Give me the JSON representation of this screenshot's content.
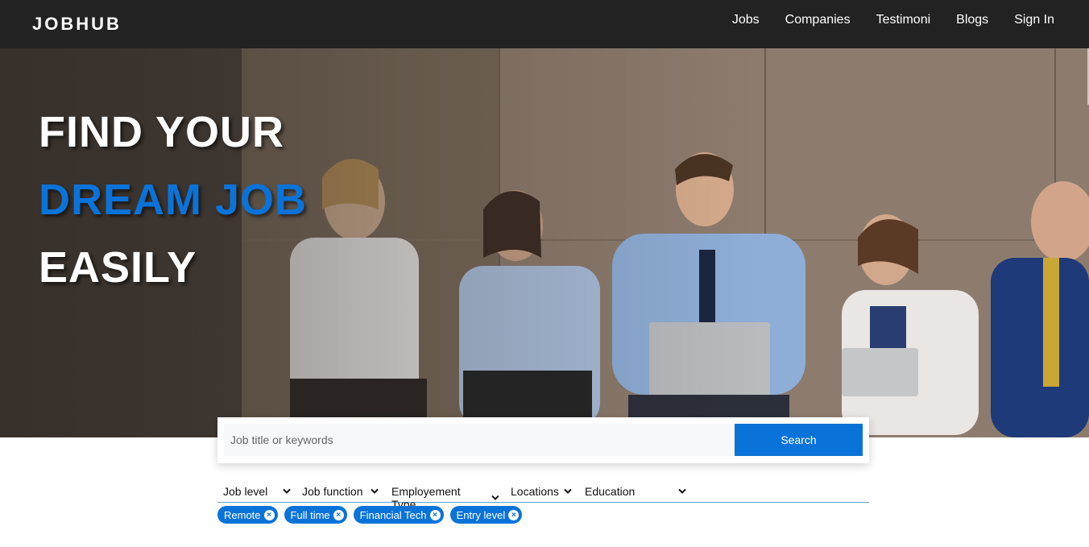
{
  "navbar": {
    "logo": "JOBHUB",
    "links": [
      "Jobs",
      "Companies",
      "Testimoni",
      "Blogs",
      "Sign In"
    ]
  },
  "hero": {
    "line1": "FIND YOUR",
    "line2": "DREAM JOB",
    "line3": "EASILY"
  },
  "search": {
    "placeholder": "Job title or keywords",
    "value": "",
    "button": "Search"
  },
  "filters": [
    "Job level",
    "Job function",
    "Employement Type",
    "Locations",
    "Education"
  ],
  "chips": [
    "Remote",
    "Full time",
    "Financial Tech",
    "Entry level"
  ],
  "colors": {
    "accent": "#0a73d9",
    "navbar": "#222222"
  }
}
